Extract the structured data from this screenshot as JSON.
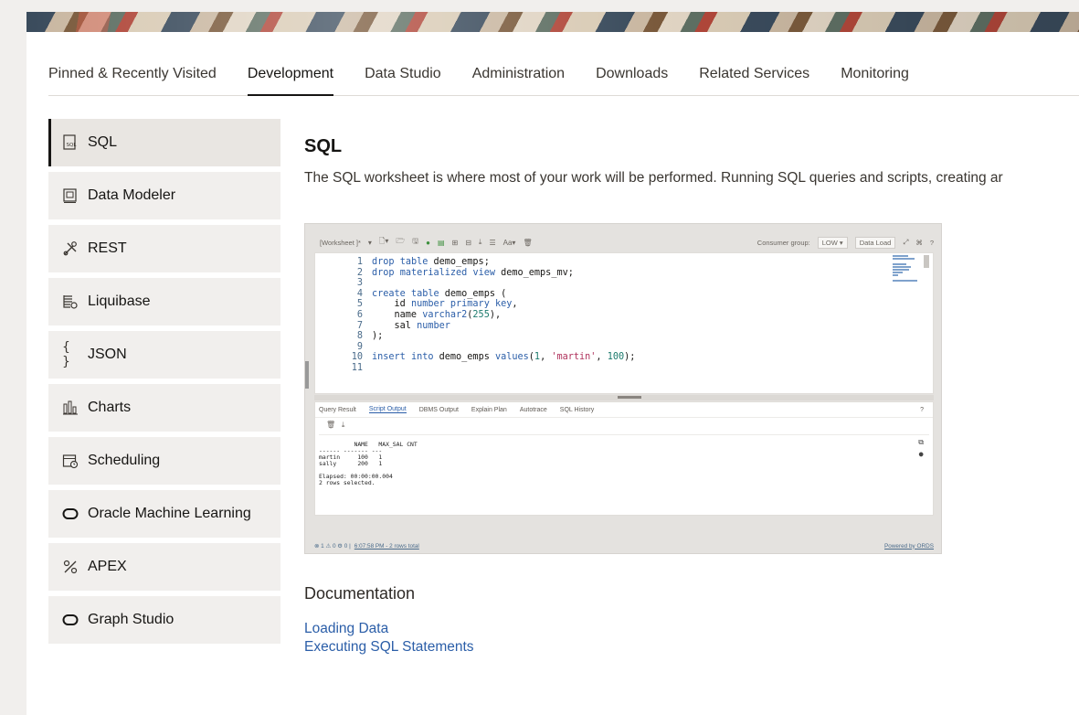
{
  "tabs": [
    {
      "label": "Pinned & Recently Visited",
      "active": false
    },
    {
      "label": "Development",
      "active": true
    },
    {
      "label": "Data Studio",
      "active": false
    },
    {
      "label": "Administration",
      "active": false
    },
    {
      "label": "Downloads",
      "active": false
    },
    {
      "label": "Related Services",
      "active": false
    },
    {
      "label": "Monitoring",
      "active": false
    }
  ],
  "sidebar": {
    "items": [
      {
        "label": "SQL",
        "icon": "sql-icon",
        "active": true
      },
      {
        "label": "Data Modeler",
        "icon": "data-modeler-icon"
      },
      {
        "label": "REST",
        "icon": "rest-icon"
      },
      {
        "label": "Liquibase",
        "icon": "liquibase-icon"
      },
      {
        "label": "JSON",
        "icon": "json-icon"
      },
      {
        "label": "Charts",
        "icon": "charts-icon"
      },
      {
        "label": "Scheduling",
        "icon": "scheduling-icon"
      },
      {
        "label": "Oracle Machine Learning",
        "icon": "oml-icon"
      },
      {
        "label": "APEX",
        "icon": "apex-icon"
      },
      {
        "label": "Graph Studio",
        "icon": "graph-studio-icon"
      }
    ]
  },
  "main": {
    "title": "SQL",
    "description": "The SQL worksheet is where most of your work will be performed. Running SQL queries and scripts, creating ar",
    "screenshot": {
      "worksheet_label": "[Worksheet ]*",
      "consumer_group_label": "Consumer group:",
      "consumer_group_value": "LOW",
      "data_load_label": "Data Load",
      "code_lines": [
        {
          "n": "1",
          "text": "drop table demo_emps;"
        },
        {
          "n": "2",
          "text": "drop materialized view demo_emps_mv;"
        },
        {
          "n": "3",
          "text": ""
        },
        {
          "n": "4",
          "text": "create table demo_emps ("
        },
        {
          "n": "5",
          "text": "    id number primary key,"
        },
        {
          "n": "6",
          "text": "    name varchar2(255),"
        },
        {
          "n": "7",
          "text": "    sal number"
        },
        {
          "n": "8",
          "text": ");"
        },
        {
          "n": "9",
          "text": ""
        },
        {
          "n": "10",
          "text": "insert into demo_emps values(1, 'martin', 100);"
        },
        {
          "n": "11",
          "text": ""
        }
      ],
      "result_tabs": [
        "Query Result",
        "Script Output",
        "DBMS Output",
        "Explain Plan",
        "Autotrace",
        "SQL History"
      ],
      "active_result_tab": "Script Output",
      "output_text": "NAME   MAX_SAL CNT\n------ ------- ---\nmartin     100   1\nsally      200   1\n\nElapsed: 00:00:00.004\n2 rows selected.",
      "status_counts": "⊗ 1  ⚠ 0  ⚙ 0  |",
      "status_time": "6:07:58 PM - 2 rows total",
      "powered_by": "Powered by ORDS"
    },
    "documentation_title": "Documentation",
    "doc_links": [
      "Loading Data",
      "Executing SQL Statements"
    ]
  }
}
